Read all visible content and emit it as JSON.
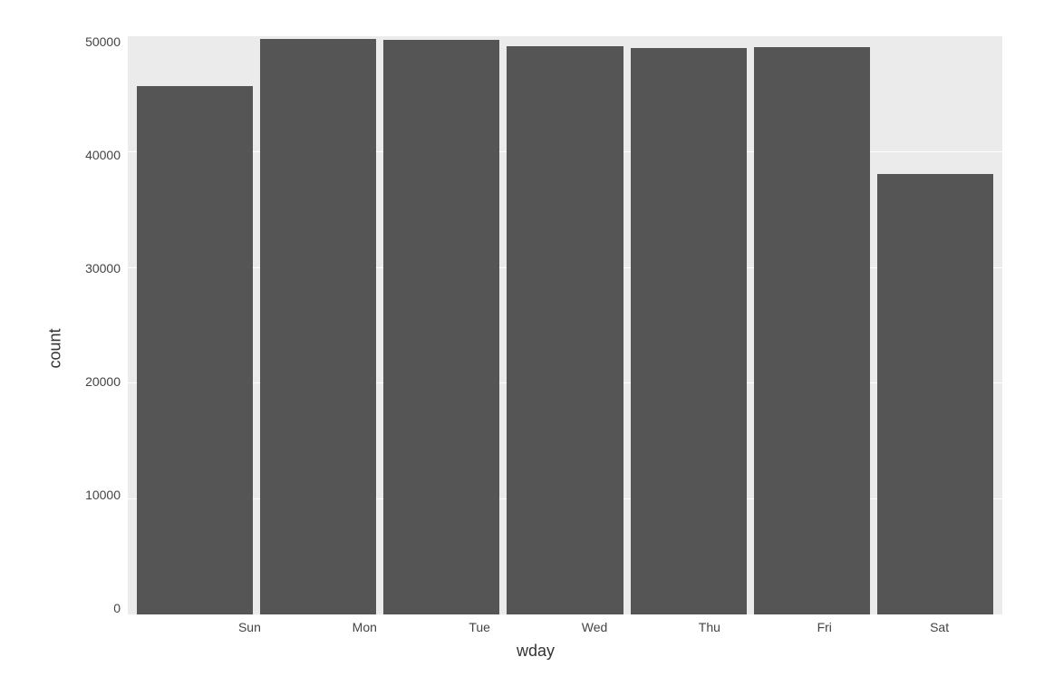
{
  "chart": {
    "y_axis_label": "count",
    "x_axis_label": "wday",
    "y_ticks": [
      "50000",
      "40000",
      "30000",
      "20000",
      "10000",
      "0"
    ],
    "x_ticks": [
      "Sun",
      "Mon",
      "Tue",
      "Wed",
      "Thu",
      "Fri",
      "Sat"
    ],
    "bars": [
      {
        "day": "Sun",
        "value": 45600,
        "height_pct": 91.2
      },
      {
        "day": "Mon",
        "value": 49700,
        "height_pct": 99.4
      },
      {
        "day": "Tue",
        "value": 49600,
        "height_pct": 99.2
      },
      {
        "day": "Wed",
        "value": 49100,
        "height_pct": 98.2
      },
      {
        "day": "Thu",
        "value": 48900,
        "height_pct": 97.8
      },
      {
        "day": "Fri",
        "value": 49000,
        "height_pct": 98.0
      },
      {
        "day": "Sat",
        "value": 38000,
        "height_pct": 76.0
      }
    ],
    "y_max": 50000,
    "bar_color": "#555555",
    "background_color": "#ebebeb",
    "grid_color": "#ffffff"
  }
}
